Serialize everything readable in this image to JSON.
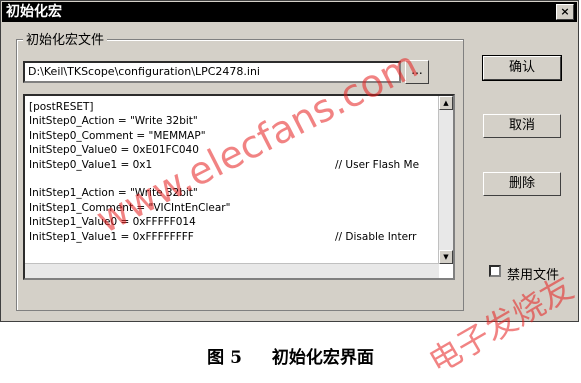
{
  "window": {
    "title": "初始化宏",
    "close_label": "×"
  },
  "group": {
    "label": "初始化宏文件"
  },
  "path_field": {
    "value": "D:\\Keil\\TKScope\\configuration\\LPC2478.ini"
  },
  "browse_button": {
    "label": "..."
  },
  "editor": {
    "lines": [
      {
        "code": "[postRESET]",
        "comment": ""
      },
      {
        "code": "InitStep0_Action = \"Write 32bit\"",
        "comment": ""
      },
      {
        "code": "InitStep0_Comment = \"MEMMAP\"",
        "comment": ""
      },
      {
        "code": "InitStep0_Value0 = 0xE01FC040",
        "comment": ""
      },
      {
        "code": "InitStep0_Value1 = 0x1",
        "comment": "// User Flash Me"
      },
      {
        "code": "",
        "comment": ""
      },
      {
        "code": "InitStep1_Action = \"Write 32bit\"",
        "comment": ""
      },
      {
        "code": "InitStep1_Comment = \"VICIntEnClear\"",
        "comment": ""
      },
      {
        "code": "InitStep1_Value0 = 0xFFFFF014",
        "comment": ""
      },
      {
        "code": "InitStep1_Value1 = 0xFFFFFFFF",
        "comment": "// Disable Interr"
      }
    ]
  },
  "buttons": {
    "ok": "确认",
    "cancel": "取消",
    "delete": "删除"
  },
  "disable_file_checkbox": {
    "label": "禁用文件",
    "checked": false
  },
  "caption": {
    "figure": "图 5",
    "text": "初始化宏界面"
  },
  "watermarks": {
    "site": "www.elecfans.com",
    "brand": "电子发烧友"
  }
}
